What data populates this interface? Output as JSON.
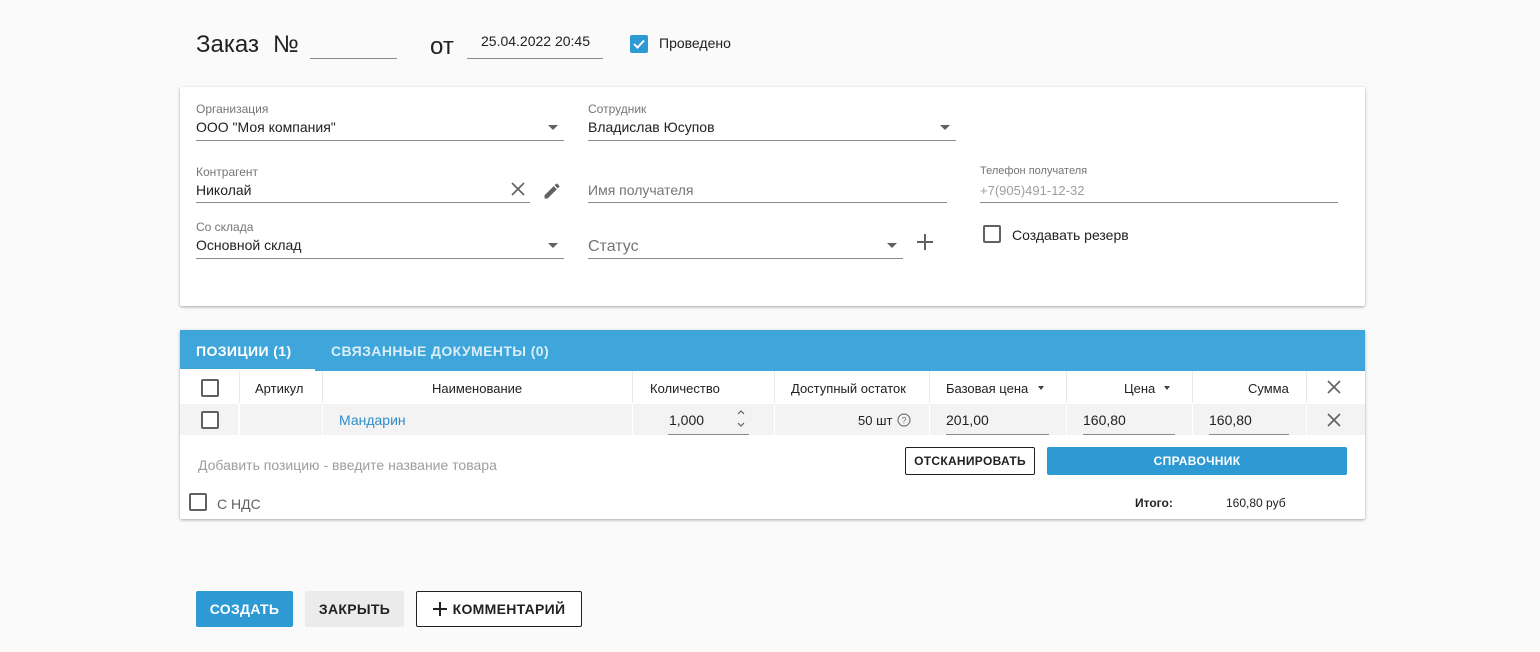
{
  "header": {
    "order_label": "Заказ",
    "number_label": "№",
    "number_value": "",
    "from_label": "от",
    "date_value": "25.04.2022 20:45",
    "posted_label": "Проведено",
    "posted_checked": true
  },
  "form": {
    "organization": {
      "label": "Организация",
      "value": "ООО \"Моя компания\""
    },
    "employee": {
      "label": "Сотрудник",
      "value": "Владислав Юсупов"
    },
    "counterparty": {
      "label": "Контрагент",
      "value": "Николай"
    },
    "recipient_name": {
      "placeholder": "Имя получателя"
    },
    "recipient_phone": {
      "label": "Телефон получателя",
      "placeholder": "+7(905)491-12-32"
    },
    "warehouse": {
      "label": "Со склада",
      "value": "Основной склад"
    },
    "status": {
      "placeholder": "Статус"
    },
    "reserve": {
      "label": "Создавать резерв",
      "checked": false
    }
  },
  "tabs": [
    {
      "label": "Позиции (1)",
      "active": true
    },
    {
      "label": "Связанные документы (0)",
      "active": false
    }
  ],
  "table": {
    "columns": [
      "Артикул",
      "Наименование",
      "Количество",
      "Доступный остаток",
      "Базовая цена",
      "Цена",
      "Сумма"
    ],
    "rows": [
      {
        "article": "",
        "name": "Мандарин",
        "quantity": "1,000",
        "available": "50 шт",
        "base_price": "201,00",
        "price": "160,80",
        "sum": "160,80"
      }
    ]
  },
  "add_position": {
    "placeholder": "Добавить позицию - введите название товара",
    "scan_label": "Отсканировать",
    "catalog_label": "Справочник"
  },
  "footer": {
    "vat_label": "С НДС",
    "total_label": "Итого:",
    "total_value": "160,80 руб"
  },
  "actions": {
    "create_label": "Создать",
    "close_label": "Закрыть",
    "comment_label": "Комментарий"
  },
  "colors": {
    "accent": "#2d9ad4",
    "tabs_bg": "#3ea6db",
    "link": "#2d8cc8"
  }
}
